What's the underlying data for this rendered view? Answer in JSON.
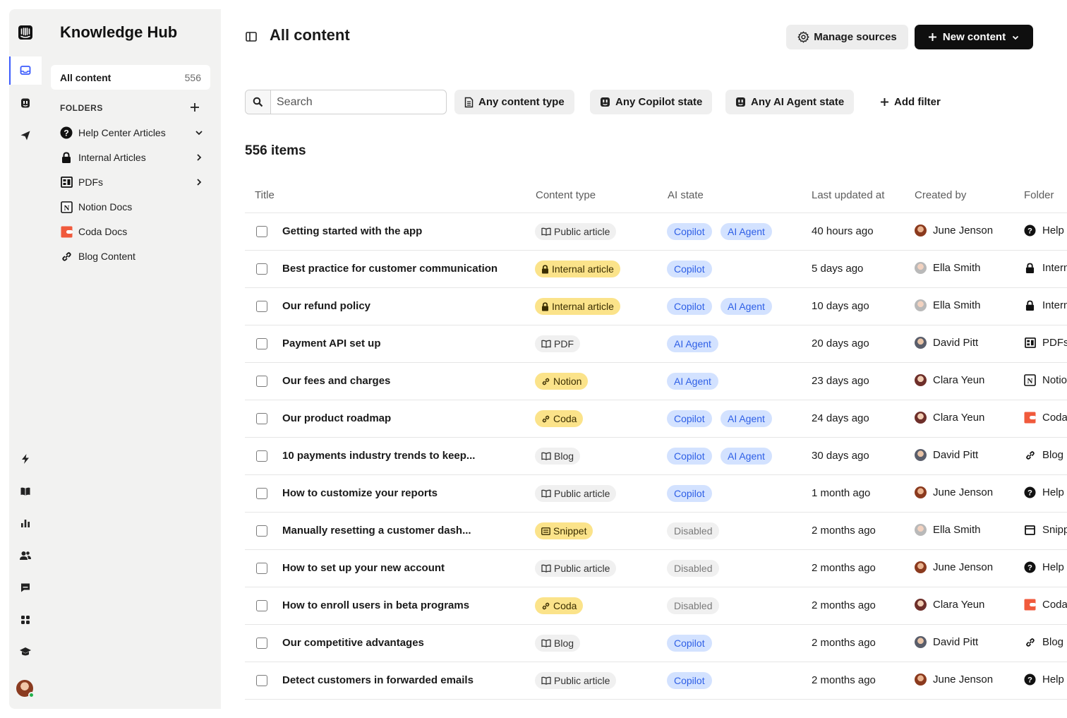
{
  "sidebar": {
    "title": "Knowledge Hub",
    "all_content": {
      "label": "All content",
      "count": "556"
    },
    "folders_label": "FOLDERS",
    "folders": [
      {
        "label": "Help Center Articles",
        "icon": "question-circle-icon",
        "expanded": true
      },
      {
        "label": "Internal Articles",
        "icon": "lock-icon",
        "expanded": false
      },
      {
        "label": "PDFs",
        "icon": "pdf-icon",
        "expanded": false
      },
      {
        "label": "Notion Docs",
        "icon": "notion-icon"
      },
      {
        "label": "Coda Docs",
        "icon": "coda-icon"
      },
      {
        "label": "Blog Content",
        "icon": "link-icon"
      }
    ]
  },
  "header": {
    "title": "All content",
    "manage_sources": "Manage sources",
    "new_content": "New content"
  },
  "filters": {
    "search_placeholder": "Search",
    "content_type": "Any content type",
    "copilot_state": "Any Copilot state",
    "agent_state": "Any AI Agent state",
    "add_filter": "Add filter"
  },
  "items_count": "556 items",
  "table": {
    "columns": [
      "Title",
      "Content type",
      "AI state",
      "Last updated at",
      "Created by",
      "Folder"
    ],
    "rows": [
      {
        "title": "Getting started with the app",
        "type": "Public article",
        "type_style": "gray",
        "type_icon": "book",
        "ai": [
          "Copilot",
          "AI Agent"
        ],
        "updated": "40 hours ago",
        "creator": "June Jenson",
        "folder": "Help Center Articles",
        "folder_icon": "question"
      },
      {
        "title": "Best practice for customer communication",
        "type": "Internal article",
        "type_style": "yellow",
        "type_icon": "lock",
        "ai": [
          "Copilot"
        ],
        "updated": "5 days ago",
        "creator": "Ella Smith",
        "folder": "Internal Articles",
        "folder_icon": "lock"
      },
      {
        "title": "Our refund policy",
        "type": "Internal article",
        "type_style": "yellow",
        "type_icon": "lock",
        "ai": [
          "Copilot",
          "AI Agent"
        ],
        "updated": "10 days ago",
        "creator": "Ella Smith",
        "folder": "Internal Articles",
        "folder_icon": "lock"
      },
      {
        "title": "Payment API set up",
        "type": "PDF",
        "type_style": "gray",
        "type_icon": "book",
        "ai": [
          "AI Agent"
        ],
        "updated": "20 days ago",
        "creator": "David Pitt",
        "folder": "PDFs",
        "folder_icon": "pdf"
      },
      {
        "title": "Our fees and charges",
        "type": "Notion",
        "type_style": "yellow",
        "type_icon": "link",
        "ai": [
          "AI Agent"
        ],
        "updated": "23 days ago",
        "creator": "Clara Yeun",
        "folder": "Notion Docs",
        "folder_icon": "notion"
      },
      {
        "title": "Our product roadmap",
        "type": "Coda",
        "type_style": "yellow",
        "type_icon": "link",
        "ai": [
          "Copilot",
          "AI Agent"
        ],
        "updated": "24 days ago",
        "creator": "Clara Yeun",
        "folder": "Coda Docs",
        "folder_icon": "coda"
      },
      {
        "title": "10 payments industry trends to keep...",
        "type": "Blog",
        "type_style": "gray",
        "type_icon": "book",
        "ai": [
          "Copilot",
          "AI Agent"
        ],
        "updated": "30 days ago",
        "creator": "David Pitt",
        "folder": "Blog Content",
        "folder_icon": "link"
      },
      {
        "title": "How to customize your reports",
        "type": "Public article",
        "type_style": "gray",
        "type_icon": "book",
        "ai": [
          "Copilot"
        ],
        "updated": "1 month ago",
        "creator": "June Jenson",
        "folder": "Help Center Articles",
        "folder_icon": "question"
      },
      {
        "title": "Manually resetting a customer dash...",
        "type": "Snippet",
        "type_style": "yellow",
        "type_icon": "snippet",
        "ai": [
          "Disabled"
        ],
        "updated": "2 months ago",
        "creator": "Ella Smith",
        "folder": "Snippets",
        "folder_icon": "snippet"
      },
      {
        "title": "How to set up your new account",
        "type": "Public article",
        "type_style": "gray",
        "type_icon": "book",
        "ai": [
          "Disabled"
        ],
        "updated": "2 months ago",
        "creator": "June Jenson",
        "folder": "Help Center Articles",
        "folder_icon": "question"
      },
      {
        "title": "How to enroll users in beta programs",
        "type": "Coda",
        "type_style": "yellow",
        "type_icon": "link",
        "ai": [
          "Disabled"
        ],
        "updated": "2 months ago",
        "creator": "Clara Yeun",
        "folder": "Coda Docs",
        "folder_icon": "coda"
      },
      {
        "title": "Our competitive advantages",
        "type": "Blog",
        "type_style": "gray",
        "type_icon": "book",
        "ai": [
          "Copilot"
        ],
        "updated": "2 months ago",
        "creator": "David Pitt",
        "folder": "Blog Content",
        "folder_icon": "link"
      },
      {
        "title": "Detect customers in forwarded emails",
        "type": "Public article",
        "type_style": "gray",
        "type_icon": "book",
        "ai": [
          "Copilot"
        ],
        "updated": "2 months ago",
        "creator": "June Jenson",
        "folder": "Help Center Articles",
        "folder_icon": "question"
      }
    ]
  },
  "colors": {
    "accent": "#3b5bfd",
    "ai_blue_bg": "#d3e2ff",
    "ai_blue_text": "#2e5fe6",
    "yellow_chip": "#fbe38a",
    "coda": "#f05a3c"
  }
}
